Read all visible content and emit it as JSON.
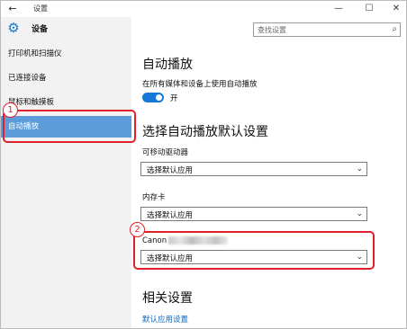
{
  "window": {
    "title": "设置",
    "back_icon": "back-arrow-icon",
    "controls": {
      "minimize": "—",
      "maximize": "☐",
      "close": "✕"
    }
  },
  "sidebar": {
    "app_title": "设备",
    "app_icon": "gear-icon",
    "items": [
      {
        "label": "打印机和扫描仪",
        "selected": false
      },
      {
        "label": "已连接设备",
        "selected": false
      },
      {
        "label": "鼠标和触摸板",
        "selected": false
      },
      {
        "label": "自动播放",
        "selected": true
      }
    ]
  },
  "search": {
    "placeholder": "查找设置",
    "icon": "search-icon"
  },
  "main": {
    "autoplay": {
      "heading": "自动播放",
      "toggle_label": "在所有媒体和设备上使用自动播放",
      "toggle_state": "开",
      "toggle_on": true
    },
    "defaults": {
      "heading": "选择自动播放默认设置",
      "items": [
        {
          "label": "可移动驱动器",
          "value": "选择默认应用"
        },
        {
          "label": "内存卡",
          "value": "选择默认应用"
        },
        {
          "label": "Canon",
          "value": "选择默认应用"
        }
      ]
    },
    "related": {
      "heading": "相关设置",
      "link": "默认应用设置"
    }
  },
  "annotations": {
    "marker_1": "1",
    "marker_2": "2",
    "color": "#e0202a"
  },
  "colors": {
    "accent": "#1478d4",
    "selected_nav": "#5c9cdb",
    "link": "#1066c2"
  }
}
